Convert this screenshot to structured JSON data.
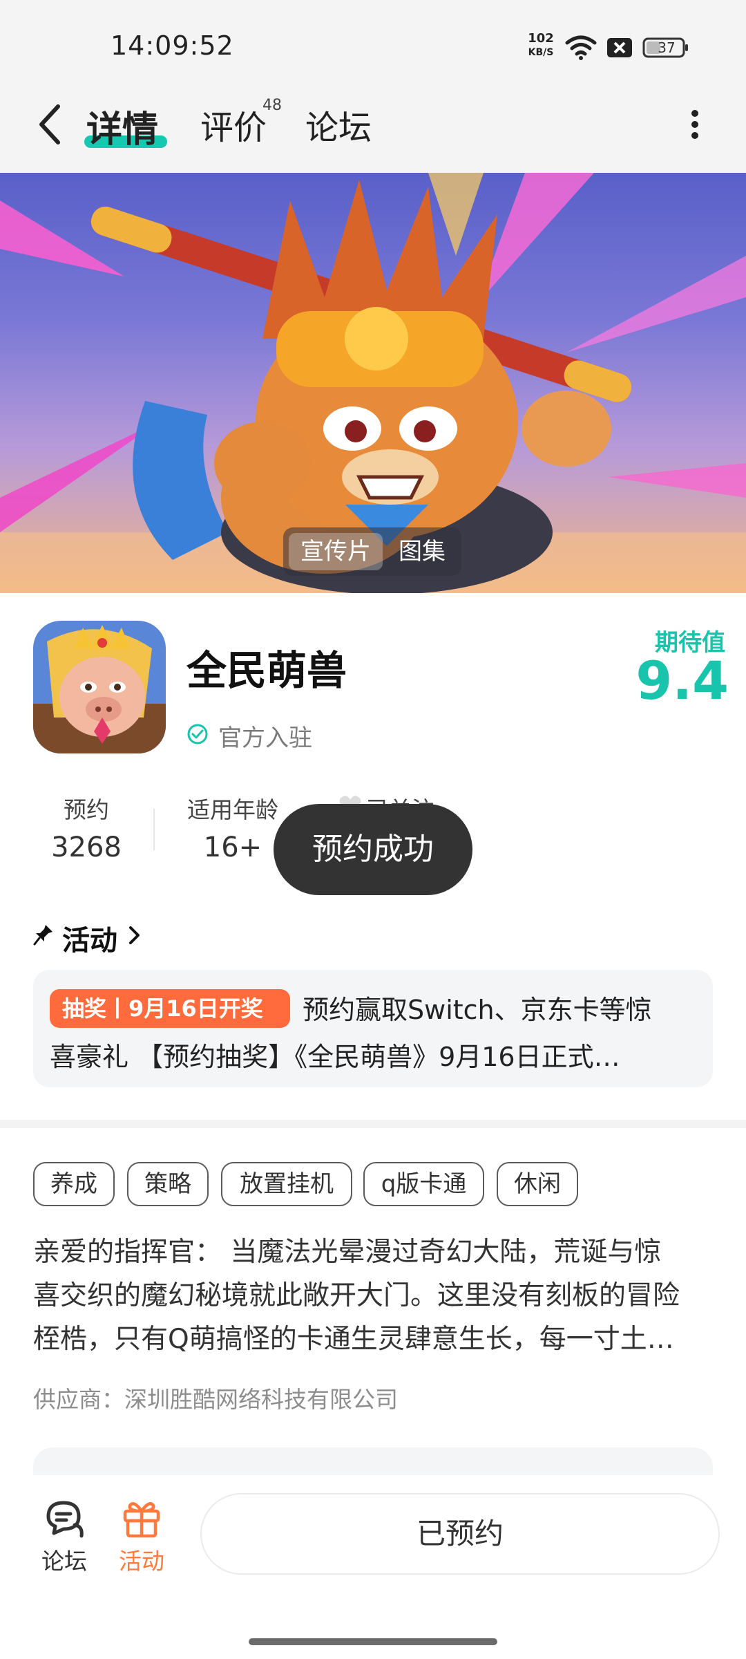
{
  "status_bar": {
    "time": "14:09:52",
    "net_speed_value": "102",
    "net_speed_unit": "KB/S",
    "battery": "37"
  },
  "header": {
    "tabs": [
      {
        "label": "详情"
      },
      {
        "label": "评价"
      },
      {
        "label": "论坛"
      }
    ],
    "reviews_count": "48",
    "accent_color": "#16c8b0"
  },
  "hero": {
    "media_tabs": [
      {
        "label": "宣传片"
      },
      {
        "label": "图集"
      }
    ]
  },
  "app": {
    "name": "全民萌兽",
    "verified_text": "官方入驻",
    "expect_label": "期待值",
    "expect_value": "9.4",
    "stats": [
      {
        "label": "预约",
        "value": "3268"
      },
      {
        "label": "适用年龄",
        "value": "16+"
      }
    ],
    "follow_label": "已关注"
  },
  "toast": {
    "text": "预约成功"
  },
  "activity": {
    "title": "活动",
    "badge": "抽奖丨9月16日开奖",
    "text_line1": "预约赢取Switch、京东卡等惊",
    "text_line2": "喜豪礼 【预约抽奖】《全民萌兽》9月16日正式…",
    "badge_color": "#ff6b3d"
  },
  "tags": [
    "养成",
    "策略",
    "放置挂机",
    "q版卡通",
    "休闲"
  ],
  "description": {
    "lines": [
      "亲爱的指挥官： 当魔法光晕漫过奇幻大陆，荒诞与惊",
      "喜交织的魔幻秘境就此敞开大门。这里没有刻板的冒险",
      "桎梏，只有Q萌搞怪的卡通生灵肆意生长，每一寸土…"
    ]
  },
  "supplier": "供应商：深圳胜酷网络科技有限公司",
  "bottom_bar": {
    "forum_label": "论坛",
    "event_label": "活动",
    "reserve_button": "已预约",
    "event_color": "#ff7a3c"
  }
}
